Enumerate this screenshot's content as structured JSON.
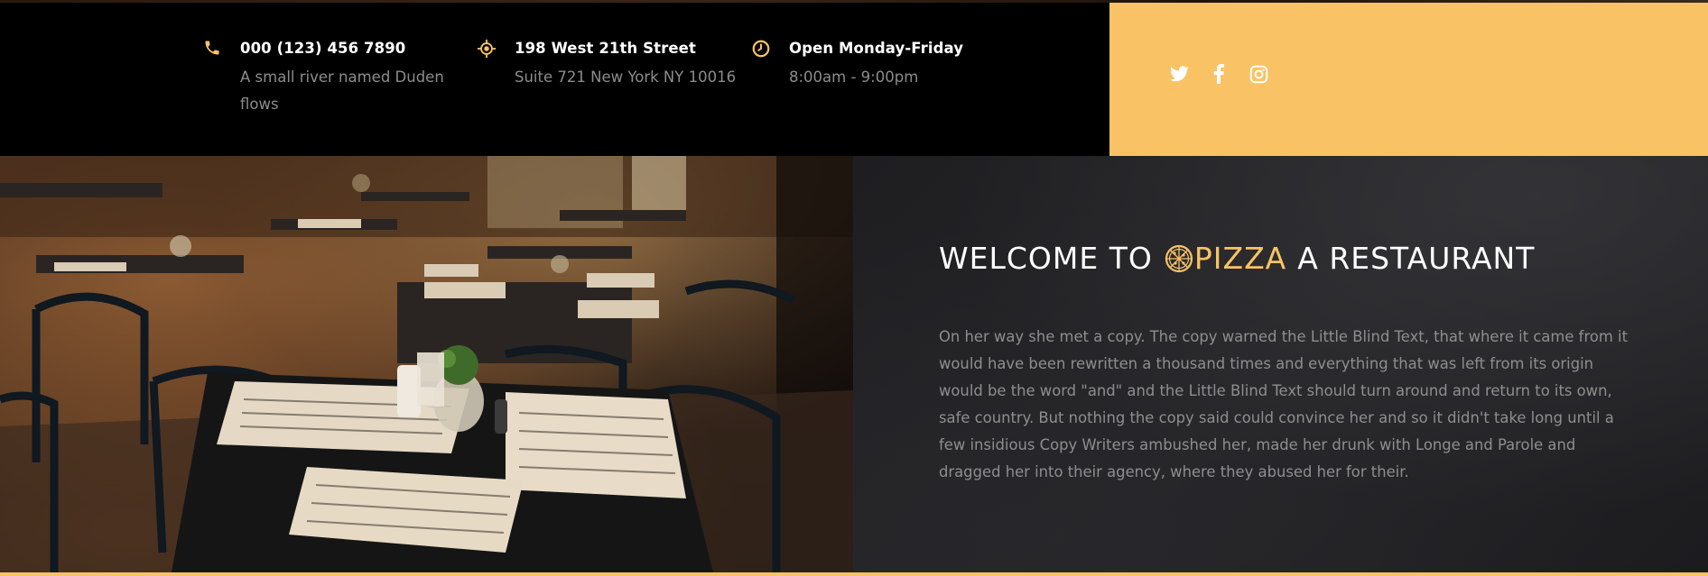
{
  "contact": {
    "phone": {
      "icon": "phone-icon",
      "title": "000 (123) 456 7890",
      "subtitle": "A small river named Duden flows"
    },
    "address": {
      "icon": "location-icon",
      "title": "198 West 21th Street",
      "subtitle": "Suite 721 New York NY 10016"
    },
    "hours": {
      "icon": "clock-icon",
      "title": "Open Monday-Friday",
      "subtitle": "8:00am - 9:00pm"
    }
  },
  "social": [
    "twitter-icon",
    "facebook-icon",
    "instagram-icon"
  ],
  "about": {
    "heading_prefix": "WELCOME TO",
    "brand": "PIZZA",
    "heading_suffix": "A RESTAURANT",
    "paragraph": "On her way she met a copy. The copy warned the Little Blind Text, that where it came from it would have been rewritten a thousand times and everything that was left from its origin would be the word \"and\" and the Little Blind Text should turn around and return to its own, safe country. But nothing the copy said could convince her and so it didn't take long until a few insidious Copy Writers ambushed her, made her drunk with Longe and Parole and dragged her into their agency, where they abused her for their."
  },
  "colors": {
    "accent": "#f9c365",
    "bar_background": "#000000",
    "section_background": "#232326",
    "muted_text": "#8e8e8e"
  }
}
